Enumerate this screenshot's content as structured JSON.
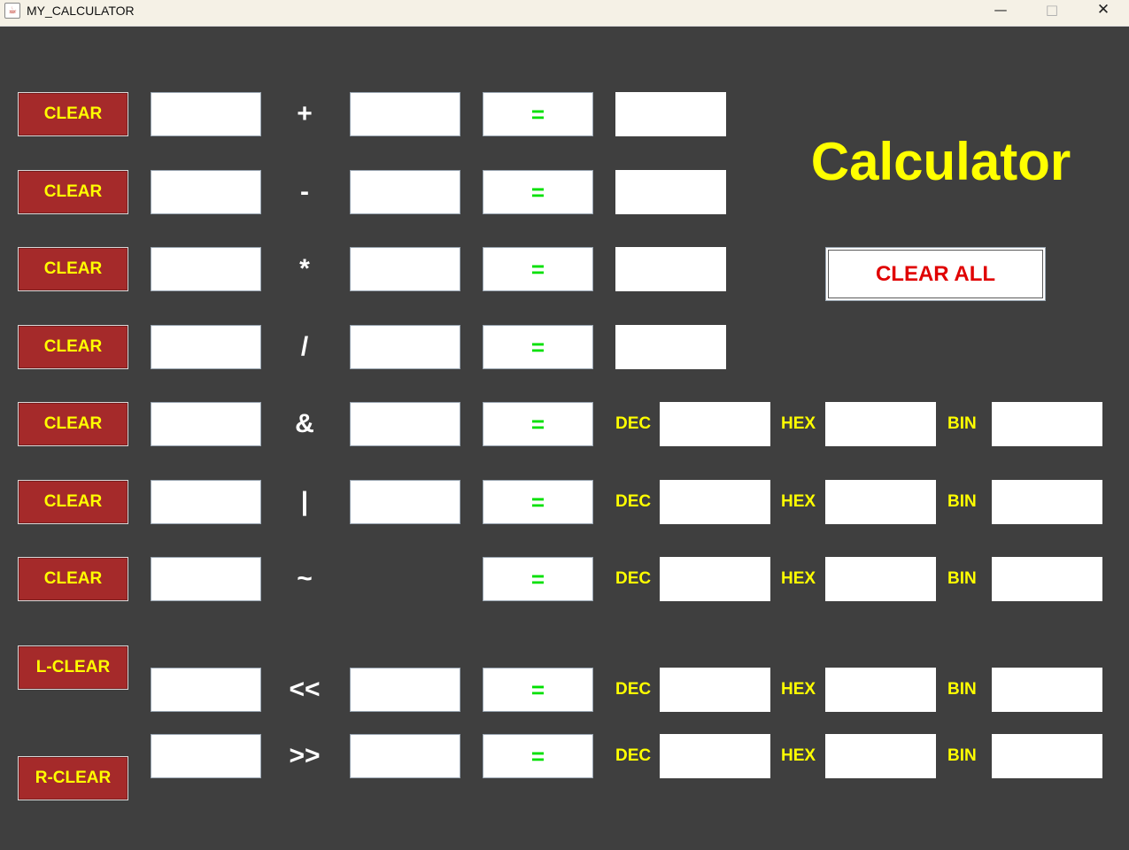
{
  "window": {
    "title": "MY_CALCULATOR",
    "icon": "java-cup-icon",
    "minimize": "—",
    "maximize": "□",
    "close": "✕"
  },
  "app": {
    "heading": "Calculator",
    "clear_all_label": "CLEAR ALL",
    "clear_label": "CLEAR",
    "left_clear_label": "L-CLEAR",
    "right_clear_label": "R-CLEAR",
    "equals_label": "=",
    "base_labels": {
      "dec": "DEC",
      "hex": "HEX",
      "bin": "BIN"
    }
  },
  "rows": [
    {
      "op": "+",
      "left": "",
      "right": "",
      "result": ""
    },
    {
      "op": "-",
      "left": "",
      "right": "",
      "result": ""
    },
    {
      "op": "*",
      "left": "",
      "right": "",
      "result": ""
    },
    {
      "op": "/",
      "left": "",
      "right": "",
      "result": ""
    },
    {
      "op": "&",
      "left": "",
      "right": "",
      "dec": "",
      "hex": "",
      "bin": ""
    },
    {
      "op": "|",
      "left": "",
      "right": "",
      "dec": "",
      "hex": "",
      "bin": ""
    },
    {
      "op": "~",
      "left": "",
      "dec": "",
      "hex": "",
      "bin": ""
    },
    {
      "op": "<<",
      "left": "",
      "right": "",
      "dec": "",
      "hex": "",
      "bin": ""
    },
    {
      "op": ">>",
      "left": "",
      "right": "",
      "dec": "",
      "hex": "",
      "bin": ""
    }
  ],
  "colors": {
    "background": "#3f3f3f",
    "clear_button": "#a52a2a",
    "label_yellow": "#ffff00",
    "equals_green": "#00e000",
    "clear_all_red": "#e00000"
  }
}
